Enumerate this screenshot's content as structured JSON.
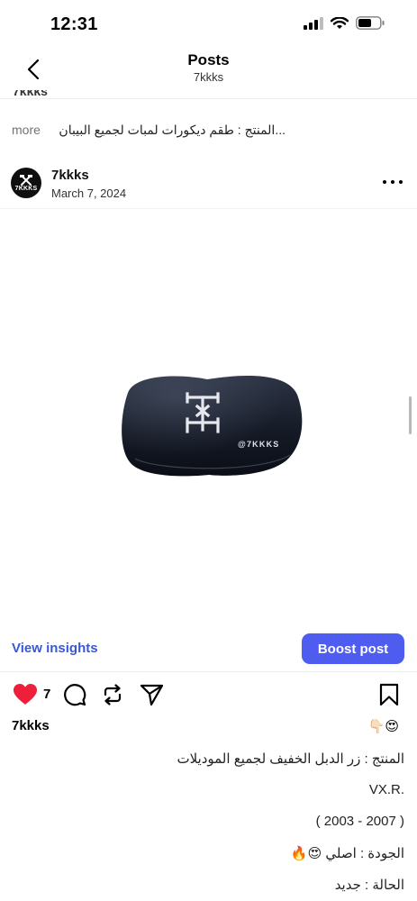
{
  "status_bar": {
    "time": "12:31"
  },
  "nav": {
    "title": "Posts",
    "subtitle": "7kkks"
  },
  "previous_post": {
    "username_cut": "7kkks",
    "caption_text": "المنتج : طقم ديكورات لمبات لجميع البيبان...",
    "more_label": "more"
  },
  "post": {
    "avatar_text": "7KKKS",
    "username": "7kkks",
    "date": "March 7, 2024",
    "image_watermark": "@7KKKS",
    "view_insights_label": "View insights",
    "boost_label": "Boost post",
    "like_count": "7",
    "caption_username": "7kkks",
    "caption_emoji": "👇🏻😍",
    "caption_lines": [
      "المنتج : زر الدبل الخفيف لجميع الموديلات",
      "VX.R.",
      "( 2003 - 2007 )",
      "الجودة : اصلي 😍🔥",
      "الحالة : جديد"
    ]
  },
  "colors": {
    "accent": "#4e5df0",
    "link": "#3a57d4",
    "like": "#ee1f3b"
  }
}
